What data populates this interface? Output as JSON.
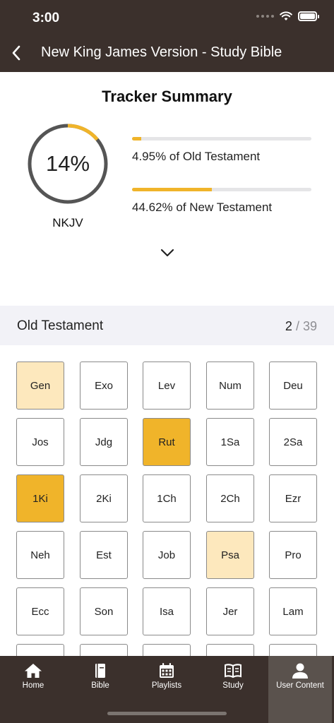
{
  "status": {
    "time": "3:00"
  },
  "header": {
    "title": "New King James Version - Study Bible"
  },
  "summary": {
    "title": "Tracker Summary",
    "overall_percent_label": "14%",
    "overall_fraction": 0.14,
    "version_label": "NKJV",
    "old_testament": {
      "label": "4.95% of Old Testament",
      "fraction": 0.0495
    },
    "new_testament": {
      "label": "44.62% of New Testament",
      "fraction": 0.4462
    }
  },
  "section": {
    "title": "Old Testament",
    "done": "2",
    "separator": "/",
    "total": "39"
  },
  "books": [
    {
      "name": "Gen",
      "status": "partial"
    },
    {
      "name": "Exo",
      "status": "none"
    },
    {
      "name": "Lev",
      "status": "none"
    },
    {
      "name": "Num",
      "status": "none"
    },
    {
      "name": "Deu",
      "status": "none"
    },
    {
      "name": "Jos",
      "status": "none"
    },
    {
      "name": "Jdg",
      "status": "none"
    },
    {
      "name": "Rut",
      "status": "complete"
    },
    {
      "name": "1Sa",
      "status": "none"
    },
    {
      "name": "2Sa",
      "status": "none"
    },
    {
      "name": "1Ki",
      "status": "complete"
    },
    {
      "name": "2Ki",
      "status": "none"
    },
    {
      "name": "1Ch",
      "status": "none"
    },
    {
      "name": "2Ch",
      "status": "none"
    },
    {
      "name": "Ezr",
      "status": "none"
    },
    {
      "name": "Neh",
      "status": "none"
    },
    {
      "name": "Est",
      "status": "none"
    },
    {
      "name": "Job",
      "status": "none"
    },
    {
      "name": "Psa",
      "status": "partial"
    },
    {
      "name": "Pro",
      "status": "none"
    },
    {
      "name": "Ecc",
      "status": "none"
    },
    {
      "name": "Son",
      "status": "none"
    },
    {
      "name": "Isa",
      "status": "none"
    },
    {
      "name": "Jer",
      "status": "none"
    },
    {
      "name": "Lam",
      "status": "none"
    },
    {
      "name": "",
      "status": "none"
    },
    {
      "name": "",
      "status": "none"
    },
    {
      "name": "",
      "status": "none"
    },
    {
      "name": "",
      "status": "none"
    },
    {
      "name": "",
      "status": "none"
    }
  ],
  "tabs": [
    {
      "label": "Home",
      "icon": "home-icon",
      "active": false
    },
    {
      "label": "Bible",
      "icon": "bible-icon",
      "active": false
    },
    {
      "label": "Playlists",
      "icon": "calendar-icon",
      "active": false
    },
    {
      "label": "Study",
      "icon": "open-book-icon",
      "active": false
    },
    {
      "label": "User Content",
      "icon": "user-icon",
      "active": true
    }
  ],
  "colors": {
    "bar_background": "#3b302c",
    "accent": "#f0b42a",
    "partial": "#fde8bd",
    "ring_track": "#555555"
  }
}
